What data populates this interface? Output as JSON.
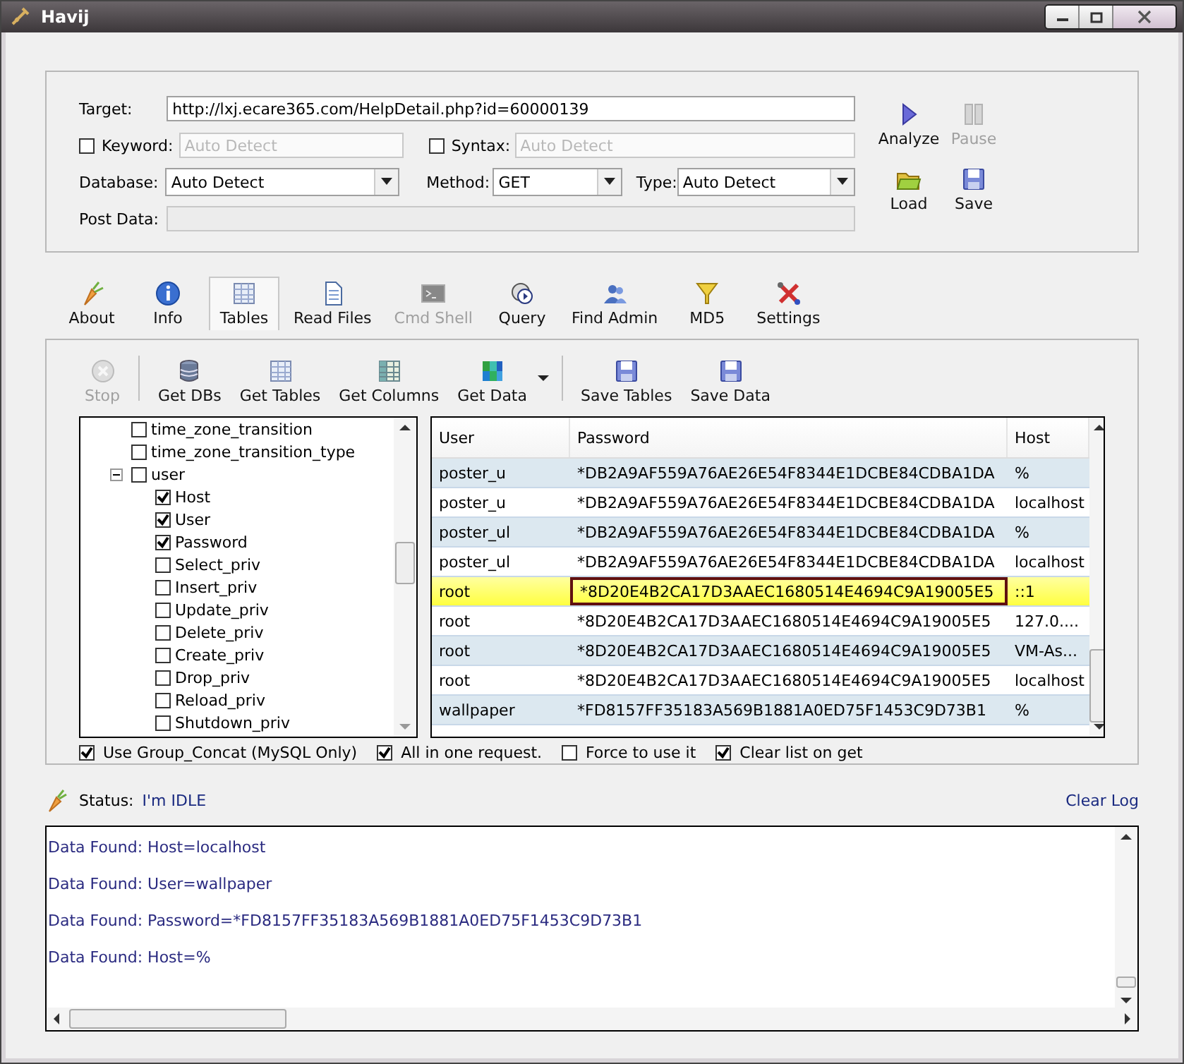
{
  "window": {
    "title": "Havij"
  },
  "target": {
    "label": "Target:",
    "value": "http://lxj.ecare365.com/HelpDetail.php?id=60000139"
  },
  "keyword": {
    "label": "Keyword:",
    "checked": false,
    "placeholder": "Auto Detect"
  },
  "syntax": {
    "label": "Syntax:",
    "checked": false,
    "placeholder": "Auto Detect"
  },
  "database": {
    "label": "Database:",
    "value": "Auto Detect"
  },
  "method": {
    "label": "Method:",
    "value": "GET"
  },
  "type": {
    "label": "Type:",
    "value": "Auto Detect"
  },
  "post_data": {
    "label": "Post Data:"
  },
  "actions": [
    {
      "label": "Analyze",
      "disabled": false
    },
    {
      "label": "Pause",
      "disabled": true
    },
    {
      "label": "Load",
      "disabled": false
    },
    {
      "label": "Save",
      "disabled": false
    }
  ],
  "tabs": [
    {
      "label": "About",
      "selected": false,
      "disabled": false
    },
    {
      "label": "Info",
      "selected": false,
      "disabled": false
    },
    {
      "label": "Tables",
      "selected": true,
      "disabled": false
    },
    {
      "label": "Read Files",
      "selected": false,
      "disabled": false
    },
    {
      "label": "Cmd Shell",
      "selected": false,
      "disabled": true
    },
    {
      "label": "Query",
      "selected": false,
      "disabled": false
    },
    {
      "label": "Find Admin",
      "selected": false,
      "disabled": false
    },
    {
      "label": "MD5",
      "selected": false,
      "disabled": false
    },
    {
      "label": "Settings",
      "selected": false,
      "disabled": false
    }
  ],
  "toolbar": [
    {
      "label": "Stop",
      "disabled": true
    },
    {
      "label": "Get DBs",
      "disabled": false
    },
    {
      "label": "Get Tables",
      "disabled": false
    },
    {
      "label": "Get Columns",
      "disabled": false
    },
    {
      "label": "Get Data",
      "disabled": false
    },
    {
      "label": "Save Tables",
      "disabled": false
    },
    {
      "label": "Save Data",
      "disabled": false
    }
  ],
  "tree": [
    {
      "label": "time_zone_transition",
      "checked": false
    },
    {
      "label": "time_zone_transition_type",
      "checked": false
    },
    {
      "label": "user",
      "checked": false,
      "expanded": true,
      "children": [
        {
          "label": "Host",
          "checked": true
        },
        {
          "label": "User",
          "checked": true
        },
        {
          "label": "Password",
          "checked": true
        },
        {
          "label": "Select_priv",
          "checked": false
        },
        {
          "label": "Insert_priv",
          "checked": false
        },
        {
          "label": "Update_priv",
          "checked": false
        },
        {
          "label": "Delete_priv",
          "checked": false
        },
        {
          "label": "Create_priv",
          "checked": false
        },
        {
          "label": "Drop_priv",
          "checked": false
        },
        {
          "label": "Reload_priv",
          "checked": false
        },
        {
          "label": "Shutdown_priv",
          "checked": false
        }
      ]
    }
  ],
  "table": {
    "columns": [
      "User",
      "Password",
      "Host"
    ],
    "rows": [
      {
        "cells": [
          "poster_u",
          "*DB2A9AF559A76AE26E54F8344E1DCBE84CDBA1DA",
          "%"
        ],
        "selected": false
      },
      {
        "cells": [
          "poster_u",
          "*DB2A9AF559A76AE26E54F8344E1DCBE84CDBA1DA",
          "localhost"
        ],
        "selected": false
      },
      {
        "cells": [
          "poster_ul",
          "*DB2A9AF559A76AE26E54F8344E1DCBE84CDBA1DA",
          "%"
        ],
        "selected": false
      },
      {
        "cells": [
          "poster_ul",
          "*DB2A9AF559A76AE26E54F8344E1DCBE84CDBA1DA",
          "localhost"
        ],
        "selected": false
      },
      {
        "cells": [
          "root",
          "*8D20E4B2CA17D3AAEC1680514E4694C9A19005E5",
          "::1"
        ],
        "selected": true
      },
      {
        "cells": [
          "root",
          "*8D20E4B2CA17D3AAEC1680514E4694C9A19005E5",
          "127.0...."
        ],
        "selected": false
      },
      {
        "cells": [
          "root",
          "*8D20E4B2CA17D3AAEC1680514E4694C9A19005E5",
          "VM-As..."
        ],
        "selected": false
      },
      {
        "cells": [
          "root",
          "*8D20E4B2CA17D3AAEC1680514E4694C9A19005E5",
          "localhost"
        ],
        "selected": false
      },
      {
        "cells": [
          "wallpaper",
          "*FD8157FF35183A569B1881A0ED75F1453C9D73B1",
          "%"
        ],
        "selected": false
      }
    ]
  },
  "options": [
    {
      "label": "Use Group_Concat (MySQL Only)",
      "checked": true
    },
    {
      "label": "All in one request.",
      "checked": true
    },
    {
      "label": "Force to use it",
      "checked": false
    },
    {
      "label": "Clear list on get",
      "checked": true
    }
  ],
  "status": {
    "label": "Status:",
    "value": "I'm IDLE",
    "clear_log": "Clear Log"
  },
  "log": [
    "Data Found: Host=localhost",
    "Data Found: User=wallpaper",
    "Data Found: Password=*FD8157FF35183A569B1881A0ED75F1453C9D73B1",
    "Data Found: Host=%"
  ]
}
